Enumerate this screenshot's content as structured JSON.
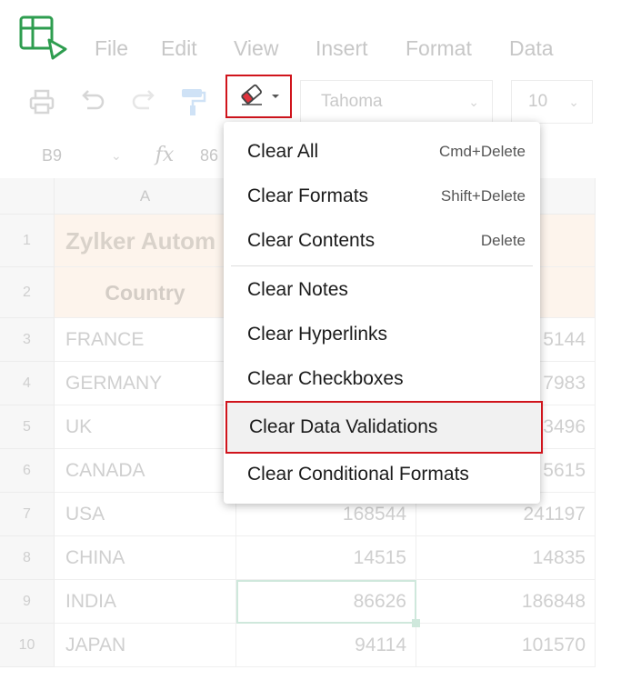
{
  "menubar": {
    "items": [
      "File",
      "Edit",
      "View",
      "Insert",
      "Format",
      "Data"
    ]
  },
  "toolbar": {
    "icons": [
      "print-icon",
      "undo-icon",
      "redo-icon",
      "format-painter-icon",
      "eraser-icon"
    ],
    "font": "Tahoma",
    "font_size": "10"
  },
  "formula_bar": {
    "cell_ref": "B9",
    "fx_symbol": "fx",
    "value": "86"
  },
  "grid": {
    "column_header_a": "A",
    "rows": [
      {
        "num": "1",
        "a": "Zylker Autom",
        "b": "",
        "c": ""
      },
      {
        "num": "2",
        "a": "Country",
        "b": "",
        "c": ""
      },
      {
        "num": "3",
        "a": "FRANCE",
        "b": "",
        "c": "5144"
      },
      {
        "num": "4",
        "a": "GERMANY",
        "b": "",
        "c": "7983"
      },
      {
        "num": "5",
        "a": "UK",
        "b": "",
        "c": "3496"
      },
      {
        "num": "6",
        "a": "CANADA",
        "b": "",
        "c": "5615"
      },
      {
        "num": "7",
        "a": "USA",
        "b": "168544",
        "c": "241197"
      },
      {
        "num": "8",
        "a": "CHINA",
        "b": "14515",
        "c": "14835"
      },
      {
        "num": "9",
        "a": "INDIA",
        "b": "86626",
        "c": "186848"
      },
      {
        "num": "10",
        "a": "JAPAN",
        "b": "94114",
        "c": "101570"
      }
    ]
  },
  "clear_menu": {
    "items": [
      {
        "label": "Clear All",
        "shortcut": "Cmd+Delete"
      },
      {
        "label": "Clear Formats",
        "shortcut": "Shift+Delete"
      },
      {
        "label": "Clear Contents",
        "shortcut": "Delete"
      },
      {
        "label": "Clear Notes",
        "shortcut": ""
      },
      {
        "label": "Clear Hyperlinks",
        "shortcut": ""
      },
      {
        "label": "Clear Checkboxes",
        "shortcut": ""
      },
      {
        "label": "Clear Data Validations",
        "shortcut": ""
      },
      {
        "label": "Clear Conditional Formats",
        "shortcut": ""
      }
    ],
    "highlighted": "Clear Data Validations"
  },
  "colors": {
    "highlight_border": "#d0141c",
    "app_green": "#2e9d4f",
    "header_band": "#fdf4ec"
  }
}
